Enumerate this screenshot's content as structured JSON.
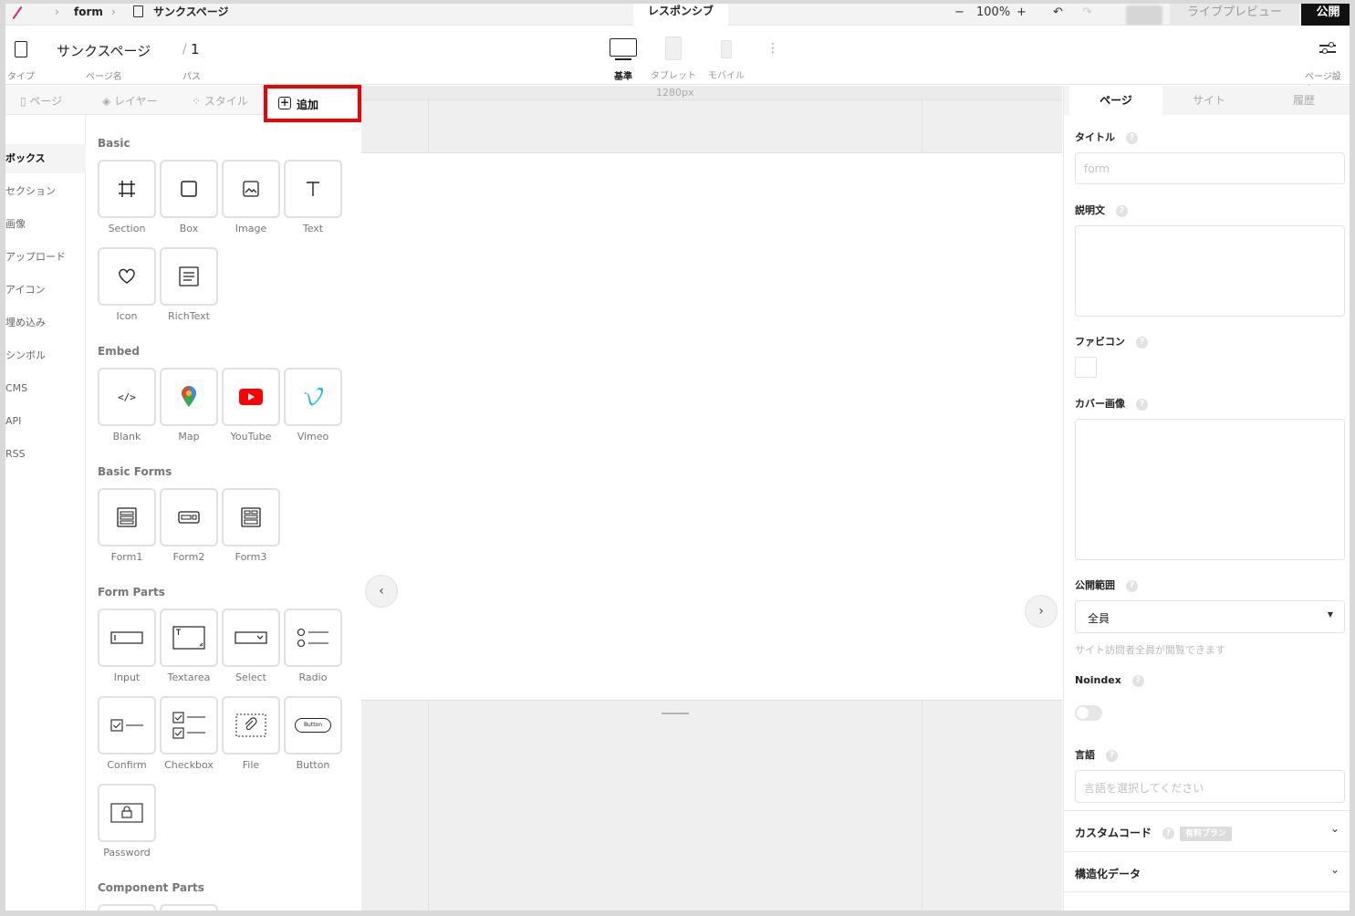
{
  "topbar": {
    "breadcrumb": [
      "form",
      "サンクスページ"
    ],
    "responsive_tab": "レスポンシブ",
    "zoom": "100%",
    "preview": "ライブプレビュー",
    "publish": "公開"
  },
  "page_bar": {
    "type_label": "タイプ",
    "page_name": "サンクスページ",
    "page_name_label": "ページ名",
    "path": "1",
    "path_label": "パス",
    "devices": [
      {
        "label": "基準",
        "active": true
      },
      {
        "label": "タブレット",
        "active": false
      },
      {
        "label": "モバイル",
        "active": false
      }
    ],
    "settings_label": "ページ設定"
  },
  "left_tabs": [
    "ページ",
    "レイヤー",
    "スタイル"
  ],
  "add_tab": "追加",
  "categories": [
    {
      "label": "ボックス",
      "active": true
    },
    {
      "label": "セクション"
    },
    {
      "label": "画像"
    },
    {
      "label": "アップロード"
    },
    {
      "label": "アイコン"
    },
    {
      "label": "埋め込み"
    },
    {
      "label": "シンボル"
    },
    {
      "label": "CMS"
    },
    {
      "label": "API"
    },
    {
      "label": "RSS"
    }
  ],
  "groups": {
    "basic": {
      "title": "Basic",
      "items": [
        "Section",
        "Box",
        "Image",
        "Text",
        "Icon",
        "RichText"
      ]
    },
    "embed": {
      "title": "Embed",
      "items": [
        "Blank",
        "Map",
        "YouTube",
        "Vimeo"
      ]
    },
    "forms": {
      "title": "Basic Forms",
      "items": [
        "Form1",
        "Form2",
        "Form3"
      ]
    },
    "parts": {
      "title": "Form Parts",
      "items": [
        "Input",
        "Textarea",
        "Select",
        "Radio",
        "Confirm",
        "Checkbox",
        "File",
        "Button",
        "Password"
      ]
    },
    "component": {
      "title": "Component Parts"
    }
  },
  "canvas": {
    "ruler_label": "1280px"
  },
  "right": {
    "tabs": [
      "ページ",
      "サイト",
      "履歴"
    ],
    "title_label": "タイトル",
    "title_placeholder": "form",
    "desc_label": "説明文",
    "favicon_label": "ファビコン",
    "cover_label": "カバー画像",
    "visibility_label": "公開範囲",
    "visibility_value": "全員",
    "visibility_hint": "サイト訪問者全員が閲覧できます",
    "noindex_label": "Noindex",
    "noindex_on": false,
    "lang_label": "言語",
    "lang_placeholder": "言語を選択してください",
    "custom_code": "カスタムコード",
    "paid_badge": "有料プラン",
    "structured": "構造化データ"
  },
  "colors": {
    "highlight": "#f00000",
    "publish_bg": "#111111",
    "youtube": "#ff0000",
    "vimeo": "#1ab7ea"
  }
}
